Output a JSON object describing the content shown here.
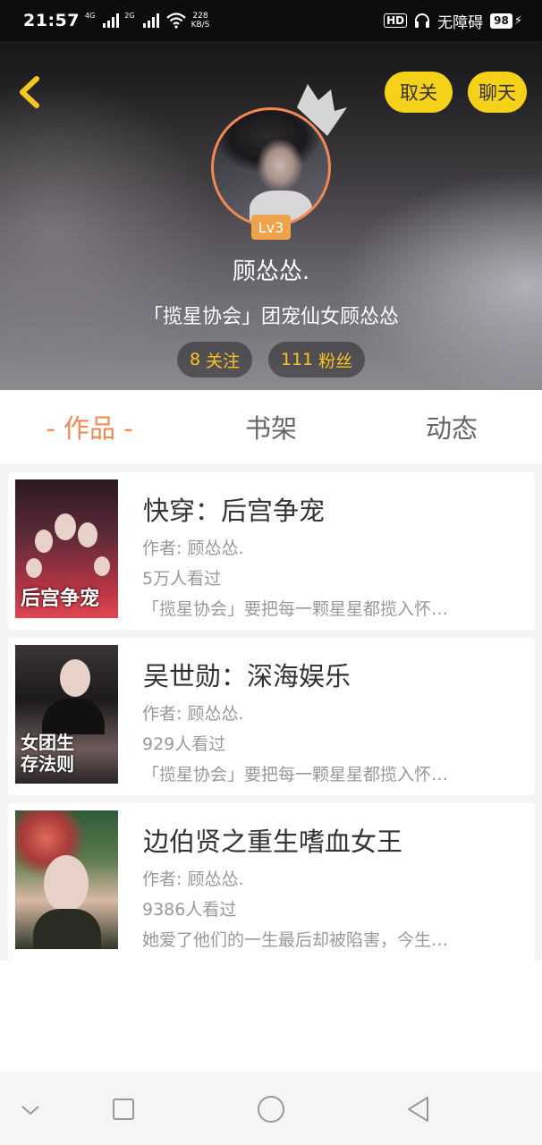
{
  "status_bar": {
    "time": "21:57",
    "net1": "4G",
    "net2": "2G",
    "speed_value": "228",
    "speed_unit": "KB/S",
    "hd": "HD",
    "accessibility": "无障碍",
    "battery": "98"
  },
  "header": {
    "unfollow_label": "取关",
    "chat_label": "聊天",
    "level": "Lv3",
    "username": "顾怂怂.",
    "signature": "「揽星协会」团宠仙女顾怂怂",
    "following_count": "8",
    "following_label": "关注",
    "fans_count": "111",
    "fans_label": "粉丝"
  },
  "tabs": [
    {
      "label": "- 作品 -",
      "active": true
    },
    {
      "label": "书架",
      "active": false
    },
    {
      "label": "动态",
      "active": false
    }
  ],
  "books": [
    {
      "title": "快穿：后宫争宠",
      "author": "作者: 顾怂怂.",
      "views": "5万人看过",
      "desc": "「揽星协会」要把每一颗星星都揽入怀…",
      "cover_text": "后宫争宠"
    },
    {
      "title": "吴世勋：深海娱乐",
      "author": "作者: 顾怂怂.",
      "views": "929人看过",
      "desc": "「揽星协会」要把每一颗星星都揽入怀…",
      "cover_text": "女团生存法则"
    },
    {
      "title": "边伯贤之重生嗜血女王",
      "author": "作者: 顾怂怂.",
      "views": "9386人看过",
      "desc": "她爱了他们的一生最后却被陷害，今生…",
      "cover_text": ""
    }
  ],
  "colors": {
    "accent": "#ef8a56",
    "button_yellow": "#f6d119",
    "stat_text": "#f6c620",
    "level_badge": "#eea34a"
  },
  "icons": {
    "back": "chevron-left-icon",
    "crown": "crown-icon",
    "nav": [
      "chevron-down-icon",
      "square-icon",
      "circle-icon",
      "triangle-back-icon"
    ]
  }
}
